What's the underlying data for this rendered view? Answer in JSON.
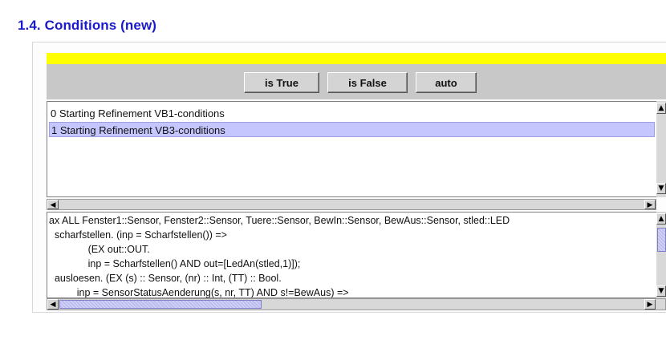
{
  "section": {
    "title": "1.4. Conditions (new)"
  },
  "toolbar": {
    "is_true_label": "is True",
    "is_false_label": "is False",
    "auto_label": "auto"
  },
  "refinements": {
    "items": [
      {
        "label": "0 Starting Refinement VB1-conditions",
        "selected": false
      },
      {
        "label": "1 Starting Refinement VB3-conditions",
        "selected": true
      }
    ]
  },
  "code": {
    "lines": [
      "ax ALL Fenster1::Sensor, Fenster2::Sensor, Tuere::Sensor, BewIn::Sensor, BewAus::Sensor, stled::LED",
      "  scharfstellen. (inp = Scharfstellen()) =>",
      "              (EX out::OUT.",
      "              inp = Scharfstellen() AND out=[LedAn(stled,1)]);",
      "  ausloesen. (EX (s) :: Sensor, (nr) :: Int, (TT) :: Bool.",
      "          inp = SensorStatusAenderung(s, nr, TT) AND s!=BewAus) =>"
    ]
  },
  "colors": {
    "heading": "#1a1acc",
    "accent_bar": "#ffff00",
    "selection": "#c6c6ff",
    "scroll_thumb": "#bcbcf0"
  }
}
